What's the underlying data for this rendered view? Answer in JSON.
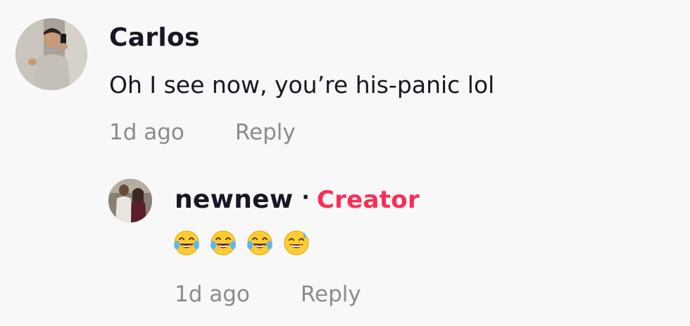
{
  "comments": [
    {
      "username": "Carlos",
      "text": "Oh I see now, you’re his-panic lol",
      "timestamp": "1d ago",
      "reply_label": "Reply",
      "avatar_icon": "user-avatar-photo"
    }
  ],
  "reply": {
    "username": "newnew",
    "separator": "·",
    "badge": "Creator",
    "emojis": [
      "face-with-tears-of-joy",
      "face-with-tears-of-joy",
      "face-with-tears-of-joy",
      "grinning-face-with-sweat"
    ],
    "timestamp": "1d ago",
    "reply_label": "Reply",
    "avatar_icon": "user-avatar-photo"
  },
  "colors": {
    "background": "#f8f8f8",
    "text": "#161823",
    "muted": "#8a8b91",
    "creator_badge": "#fe2c55"
  }
}
